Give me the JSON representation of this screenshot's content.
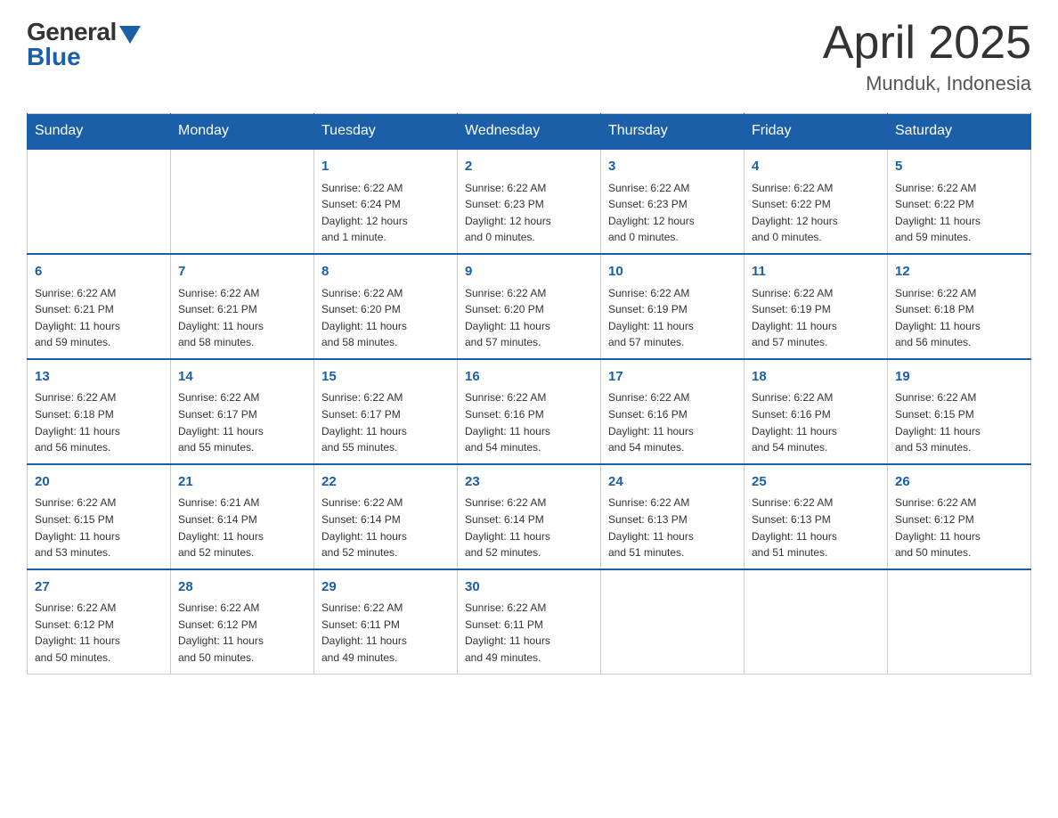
{
  "header": {
    "logo_general": "General",
    "logo_blue": "Blue",
    "title": "April 2025",
    "location": "Munduk, Indonesia"
  },
  "days_of_week": [
    "Sunday",
    "Monday",
    "Tuesday",
    "Wednesday",
    "Thursday",
    "Friday",
    "Saturday"
  ],
  "weeks": [
    [
      {
        "day": "",
        "info": ""
      },
      {
        "day": "",
        "info": ""
      },
      {
        "day": "1",
        "info": "Sunrise: 6:22 AM\nSunset: 6:24 PM\nDaylight: 12 hours\nand 1 minute."
      },
      {
        "day": "2",
        "info": "Sunrise: 6:22 AM\nSunset: 6:23 PM\nDaylight: 12 hours\nand 0 minutes."
      },
      {
        "day": "3",
        "info": "Sunrise: 6:22 AM\nSunset: 6:23 PM\nDaylight: 12 hours\nand 0 minutes."
      },
      {
        "day": "4",
        "info": "Sunrise: 6:22 AM\nSunset: 6:22 PM\nDaylight: 12 hours\nand 0 minutes."
      },
      {
        "day": "5",
        "info": "Sunrise: 6:22 AM\nSunset: 6:22 PM\nDaylight: 11 hours\nand 59 minutes."
      }
    ],
    [
      {
        "day": "6",
        "info": "Sunrise: 6:22 AM\nSunset: 6:21 PM\nDaylight: 11 hours\nand 59 minutes."
      },
      {
        "day": "7",
        "info": "Sunrise: 6:22 AM\nSunset: 6:21 PM\nDaylight: 11 hours\nand 58 minutes."
      },
      {
        "day": "8",
        "info": "Sunrise: 6:22 AM\nSunset: 6:20 PM\nDaylight: 11 hours\nand 58 minutes."
      },
      {
        "day": "9",
        "info": "Sunrise: 6:22 AM\nSunset: 6:20 PM\nDaylight: 11 hours\nand 57 minutes."
      },
      {
        "day": "10",
        "info": "Sunrise: 6:22 AM\nSunset: 6:19 PM\nDaylight: 11 hours\nand 57 minutes."
      },
      {
        "day": "11",
        "info": "Sunrise: 6:22 AM\nSunset: 6:19 PM\nDaylight: 11 hours\nand 57 minutes."
      },
      {
        "day": "12",
        "info": "Sunrise: 6:22 AM\nSunset: 6:18 PM\nDaylight: 11 hours\nand 56 minutes."
      }
    ],
    [
      {
        "day": "13",
        "info": "Sunrise: 6:22 AM\nSunset: 6:18 PM\nDaylight: 11 hours\nand 56 minutes."
      },
      {
        "day": "14",
        "info": "Sunrise: 6:22 AM\nSunset: 6:17 PM\nDaylight: 11 hours\nand 55 minutes."
      },
      {
        "day": "15",
        "info": "Sunrise: 6:22 AM\nSunset: 6:17 PM\nDaylight: 11 hours\nand 55 minutes."
      },
      {
        "day": "16",
        "info": "Sunrise: 6:22 AM\nSunset: 6:16 PM\nDaylight: 11 hours\nand 54 minutes."
      },
      {
        "day": "17",
        "info": "Sunrise: 6:22 AM\nSunset: 6:16 PM\nDaylight: 11 hours\nand 54 minutes."
      },
      {
        "day": "18",
        "info": "Sunrise: 6:22 AM\nSunset: 6:16 PM\nDaylight: 11 hours\nand 54 minutes."
      },
      {
        "day": "19",
        "info": "Sunrise: 6:22 AM\nSunset: 6:15 PM\nDaylight: 11 hours\nand 53 minutes."
      }
    ],
    [
      {
        "day": "20",
        "info": "Sunrise: 6:22 AM\nSunset: 6:15 PM\nDaylight: 11 hours\nand 53 minutes."
      },
      {
        "day": "21",
        "info": "Sunrise: 6:21 AM\nSunset: 6:14 PM\nDaylight: 11 hours\nand 52 minutes."
      },
      {
        "day": "22",
        "info": "Sunrise: 6:22 AM\nSunset: 6:14 PM\nDaylight: 11 hours\nand 52 minutes."
      },
      {
        "day": "23",
        "info": "Sunrise: 6:22 AM\nSunset: 6:14 PM\nDaylight: 11 hours\nand 52 minutes."
      },
      {
        "day": "24",
        "info": "Sunrise: 6:22 AM\nSunset: 6:13 PM\nDaylight: 11 hours\nand 51 minutes."
      },
      {
        "day": "25",
        "info": "Sunrise: 6:22 AM\nSunset: 6:13 PM\nDaylight: 11 hours\nand 51 minutes."
      },
      {
        "day": "26",
        "info": "Sunrise: 6:22 AM\nSunset: 6:12 PM\nDaylight: 11 hours\nand 50 minutes."
      }
    ],
    [
      {
        "day": "27",
        "info": "Sunrise: 6:22 AM\nSunset: 6:12 PM\nDaylight: 11 hours\nand 50 minutes."
      },
      {
        "day": "28",
        "info": "Sunrise: 6:22 AM\nSunset: 6:12 PM\nDaylight: 11 hours\nand 50 minutes."
      },
      {
        "day": "29",
        "info": "Sunrise: 6:22 AM\nSunset: 6:11 PM\nDaylight: 11 hours\nand 49 minutes."
      },
      {
        "day": "30",
        "info": "Sunrise: 6:22 AM\nSunset: 6:11 PM\nDaylight: 11 hours\nand 49 minutes."
      },
      {
        "day": "",
        "info": ""
      },
      {
        "day": "",
        "info": ""
      },
      {
        "day": "",
        "info": ""
      }
    ]
  ]
}
